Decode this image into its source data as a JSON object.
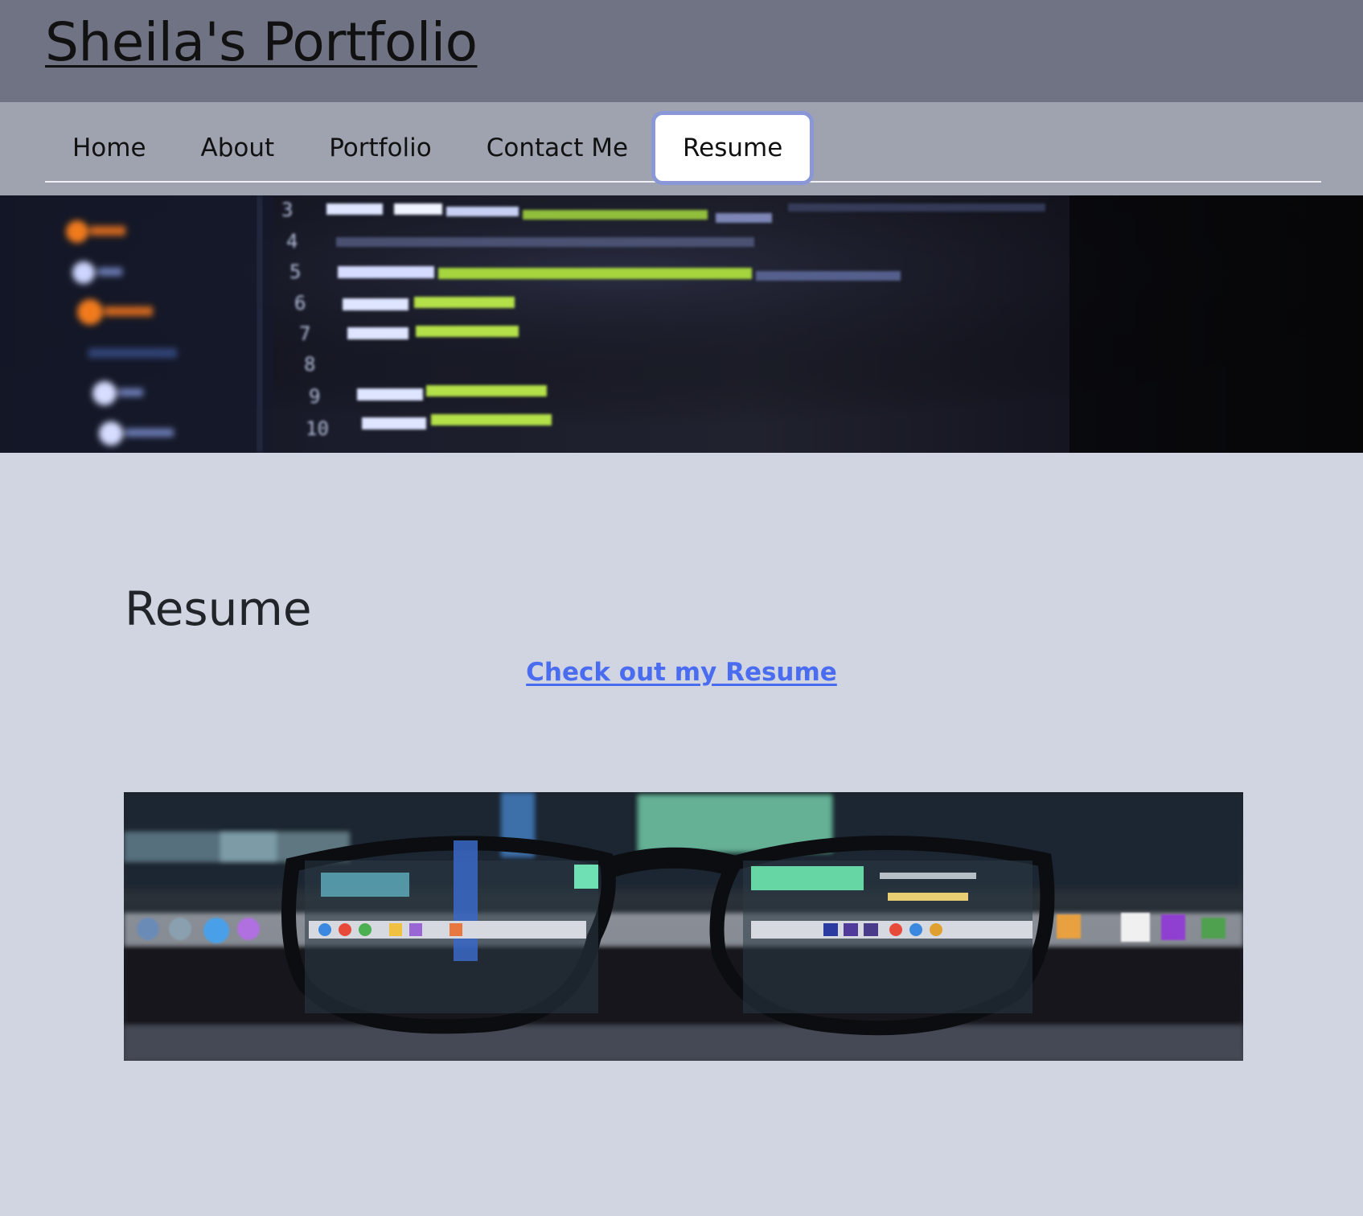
{
  "header": {
    "site_title": "Sheila's Portfolio"
  },
  "nav": {
    "tabs": [
      {
        "label": "Home"
      },
      {
        "label": "About"
      },
      {
        "label": "Portfolio"
      },
      {
        "label": "Contact Me"
      },
      {
        "label": "Resume"
      }
    ],
    "active_tab": "Resume"
  },
  "main": {
    "heading": "Resume",
    "resume_link_label": "Check out my Resume"
  },
  "colors": {
    "header_bg": "#6f7383",
    "nav_bg": "#9fa3b0",
    "page_bg": "#d0d5e1",
    "link": "#4a6cf0",
    "active_tab_outline": "#8a97d6"
  }
}
